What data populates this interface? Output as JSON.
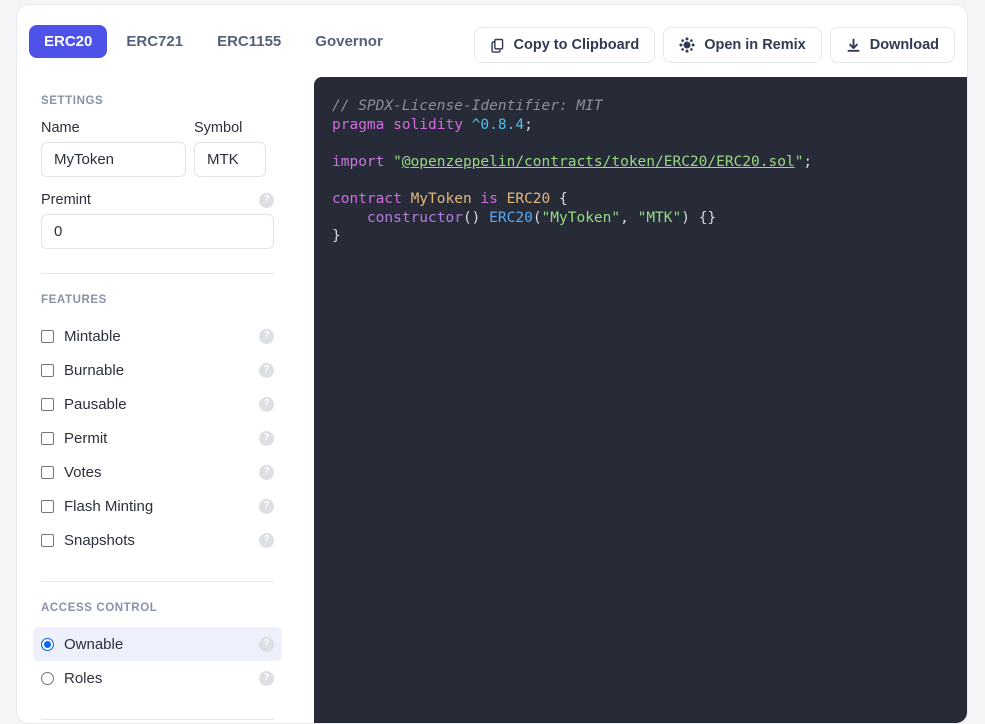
{
  "header": {
    "tabs": [
      {
        "label": "ERC20",
        "active": true
      },
      {
        "label": "ERC721",
        "active": false
      },
      {
        "label": "ERC1155",
        "active": false
      },
      {
        "label": "Governor",
        "active": false
      }
    ],
    "actions": [
      {
        "label": "Copy to Clipboard",
        "icon": "copy-icon"
      },
      {
        "label": "Open in Remix",
        "icon": "remix-icon"
      },
      {
        "label": "Download",
        "icon": "download-icon"
      }
    ]
  },
  "sidebar": {
    "settings": {
      "title": "SETTINGS",
      "name": {
        "label": "Name",
        "value": "MyToken",
        "placeholder": "MyToken"
      },
      "symbol": {
        "label": "Symbol",
        "value": "MTK",
        "placeholder": "MTK"
      },
      "premint": {
        "label": "Premint",
        "value": "0",
        "placeholder": "0",
        "help": "?"
      }
    },
    "features": {
      "title": "FEATURES",
      "items": [
        {
          "label": "Mintable",
          "checked": false,
          "help": "?"
        },
        {
          "label": "Burnable",
          "checked": false,
          "help": "?"
        },
        {
          "label": "Pausable",
          "checked": false,
          "help": "?"
        },
        {
          "label": "Permit",
          "checked": false,
          "help": "?"
        },
        {
          "label": "Votes",
          "checked": false,
          "help": "?"
        },
        {
          "label": "Flash Minting",
          "checked": false,
          "help": "?"
        },
        {
          "label": "Snapshots",
          "checked": false,
          "help": "?"
        }
      ]
    },
    "access_control": {
      "title": "ACCESS CONTROL",
      "items": [
        {
          "label": "Ownable",
          "selected": true,
          "help": "?"
        },
        {
          "label": "Roles",
          "selected": false,
          "help": "?"
        }
      ]
    }
  },
  "code": {
    "comment": "// SPDX-License-Identifier: MIT",
    "pragma_kw": "pragma solidity ",
    "pragma_version": "^0.8.4",
    "semicolon": ";",
    "import_kw": "import ",
    "quote": "\"",
    "import_path": "@openzeppelin/contracts/token/ERC20/ERC20.sol",
    "contract_kw": "contract ",
    "contract_name": "MyToken",
    "is_kw": " is ",
    "base_name": "ERC20",
    "open_brace": " {",
    "constructor_indent": "    ",
    "constructor_kw": "constructor",
    "constructor_args": "() ",
    "base_call": "ERC20",
    "paren_open": "(",
    "arg_name": "\"MyToken\"",
    "arg_sep": ", ",
    "arg_symbol": "\"MTK\"",
    "paren_close": ") {}",
    "close_brace": "}"
  },
  "colors": {
    "accent": "#4e52e8",
    "code_bg": "#272b38",
    "selected_row": "#eef0fc",
    "radio_blue": "#0a68f0"
  }
}
